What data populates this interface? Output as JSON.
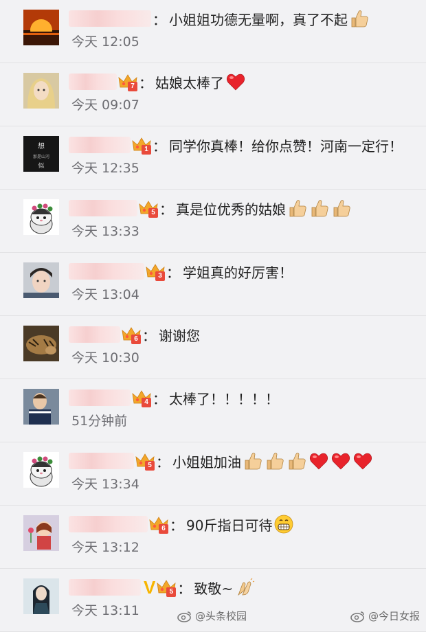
{
  "comments": [
    {
      "time": "今天 12:05",
      "text": "小姐姐功德无量啊，真了不起",
      "level": null,
      "emojis": [
        "thumbs"
      ],
      "avatar": "sunset-avatar",
      "uname_w": 120
    },
    {
      "time": "今天 09:07",
      "text": "姑娘太棒了",
      "level": "7",
      "emojis": [
        "heart"
      ],
      "avatar": "anime-girl-avatar",
      "uname_w": 70
    },
    {
      "time": "今天 12:35",
      "text": "同学你真棒！给你点赞！河南一定行！",
      "level": "1",
      "emojis": [],
      "avatar": "dark-calligraphy-avatar",
      "uname_w": 90
    },
    {
      "time": "今天 13:33",
      "text": "真是位优秀的姑娘",
      "level": "5",
      "emojis": [
        "thumbs",
        "thumbs",
        "thumbs"
      ],
      "avatar": "cat-flower-avatar",
      "uname_w": 100
    },
    {
      "time": "今天 13:04",
      "text": "学姐真的好厉害！",
      "level": "3",
      "emojis": [],
      "avatar": "young-man-avatar",
      "uname_w": 110
    },
    {
      "time": "今天 10:30",
      "text": "谢谢您",
      "level": "6",
      "emojis": [],
      "avatar": "tiger-avatar",
      "uname_w": 75
    },
    {
      "time": "51分钟前",
      "text": "太棒了！！！！！",
      "level": "4",
      "emojis": [],
      "avatar": "soccer-player-avatar",
      "uname_w": 90
    },
    {
      "time": "今天 13:34",
      "text": "小姐姐加油",
      "level": "5",
      "emojis": [
        "thumbs",
        "thumbs",
        "thumbs",
        "heart",
        "heart",
        "heart"
      ],
      "avatar": "cat-flower-avatar",
      "uname_w": 95
    },
    {
      "time": "今天 13:12",
      "text": "90斤指日可待",
      "level": "6",
      "emojis": [
        "grin"
      ],
      "avatar": "cartoon-girl-avatar",
      "uname_w": 115
    },
    {
      "time": "今天 13:11",
      "text": "致敬~",
      "level": "5",
      "emojis": [
        "pray"
      ],
      "avatar": "warrior-avatar",
      "uname_w": 105,
      "vip": "V"
    }
  ],
  "colon": "：",
  "watermarks": {
    "left": "@头条校园",
    "right": "@今日女报"
  },
  "colors": {
    "background": "#f2f2f4",
    "time": "#6e6e73",
    "crown_gold": "#f2a72a",
    "level_red": "#e94a3b"
  }
}
